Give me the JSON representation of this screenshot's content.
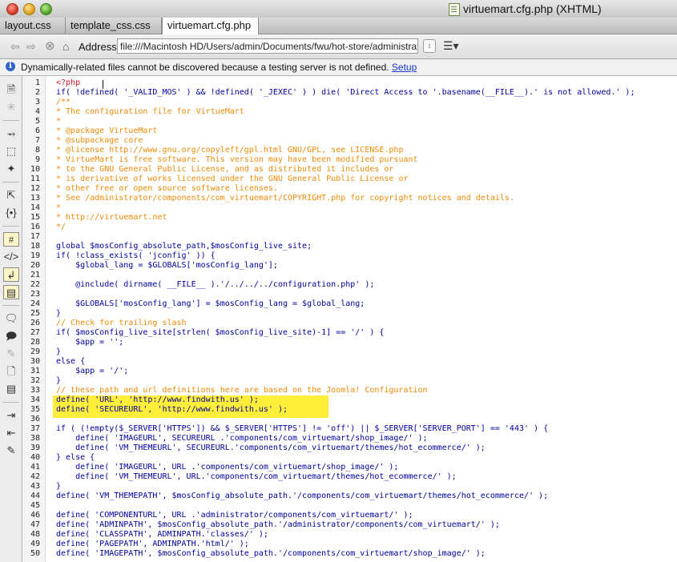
{
  "window": {
    "title": "virtuemart.cfg.php (XHTML)"
  },
  "tabs": [
    {
      "label": "layout.css",
      "active": false
    },
    {
      "label": "template_css.css",
      "active": false
    },
    {
      "label": "virtuemart.cfg.php",
      "active": true
    }
  ],
  "addressbar": {
    "label": "Address:",
    "value": "file:///Macintosh HD/Users/admin/Documents/fwu/hot-store/administrator/components/com_virtuemart/virtuemart.cfg.php"
  },
  "infobar": {
    "message": "Dynamically-related files cannot be discovered because a testing server is not defined. ",
    "link": "Setup"
  },
  "colors": {
    "php_tag": "#d8141b",
    "comment": "#ee8a09",
    "code": "#00009b",
    "highlight": "#ffef3a"
  },
  "sidebar_icons": [
    "document-icon",
    "asterisk-icon",
    "collapse-icon",
    "select-icon",
    "expand-icon",
    "select-parent-icon",
    "balance-braces-icon",
    "line-numbers-icon",
    "highlight-invalid-icon",
    "word-wrap-icon",
    "syntax-coloring-icon",
    "comment-icon",
    "uncomment-icon",
    "wrap-tag-icon",
    "recent-snippets-icon",
    "move-css-icon",
    "indent-icon",
    "outdent-icon",
    "format-source-icon"
  ],
  "code_lines": [
    {
      "n": "1",
      "t": "<?php",
      "c": "php"
    },
    {
      "n": "2",
      "t": "if( !defined( '_VALID_MOS' ) && !defined( '_JEXEC' ) ) die( 'Direct Access to '.basename(__FILE__).' is not allowed.' );",
      "c": "plain"
    },
    {
      "n": "3",
      "t": "/**",
      "c": "com"
    },
    {
      "n": "4",
      "t": "* The configuration file for VirtueMart",
      "c": "com"
    },
    {
      "n": "5",
      "t": "*",
      "c": "com"
    },
    {
      "n": "6",
      "t": "* @package VirtueMart",
      "c": "com"
    },
    {
      "n": "7",
      "t": "* @subpackage core",
      "c": "com"
    },
    {
      "n": "8",
      "t": "* @license http://www.gnu.org/copyleft/gpl.html GNU/GPL, see LICENSE.php",
      "c": "com"
    },
    {
      "n": "9",
      "t": "* VirtueMart is free software. This version may have been modified pursuant",
      "c": "com"
    },
    {
      "n": "10",
      "t": "* to the GNU General Public License, and as distributed it includes or",
      "c": "com"
    },
    {
      "n": "11",
      "t": "* is derivative of works licensed under the GNU General Public License or",
      "c": "com"
    },
    {
      "n": "12",
      "t": "* other free or open source software licenses.",
      "c": "com"
    },
    {
      "n": "13",
      "t": "* See /administrator/components/com_virtuemart/COPYRIGHT.php for copyright notices and details.",
      "c": "com"
    },
    {
      "n": "14",
      "t": "*",
      "c": "com"
    },
    {
      "n": "15",
      "t": "* http://virtuemart.net",
      "c": "com"
    },
    {
      "n": "16",
      "t": "*/",
      "c": "com"
    },
    {
      "n": "17",
      "t": "",
      "c": "plain"
    },
    {
      "n": "18",
      "t": "global $mosConfig_absolute_path,$mosConfig_live_site;",
      "c": "plain"
    },
    {
      "n": "19",
      "t": "if( !class_exists( 'jconfig' )) {",
      "c": "plain"
    },
    {
      "n": "20",
      "t": "    $global_lang = $GLOBALS['mosConfig_lang'];",
      "c": "plain"
    },
    {
      "n": "21",
      "t": "",
      "c": "plain"
    },
    {
      "n": "22",
      "t": "    @include( dirname( __FILE__ ).'/../../../configuration.php' );",
      "c": "plain"
    },
    {
      "n": "23",
      "t": "",
      "c": "plain"
    },
    {
      "n": "24",
      "t": "    $GLOBALS['mosConfig_lang'] = $mosConfig_lang = $global_lang;",
      "c": "plain"
    },
    {
      "n": "25",
      "t": "}",
      "c": "plain"
    },
    {
      "n": "26",
      "t": "// Check for trailing slash",
      "c": "com"
    },
    {
      "n": "27",
      "t": "if( $mosConfig_live_site[strlen( $mosConfig_live_site)-1] == '/' ) {",
      "c": "plain"
    },
    {
      "n": "28",
      "t": "    $app = '';",
      "c": "plain"
    },
    {
      "n": "29",
      "t": "}",
      "c": "plain"
    },
    {
      "n": "30",
      "t": "else {",
      "c": "plain"
    },
    {
      "n": "31",
      "t": "    $app = '/';",
      "c": "plain"
    },
    {
      "n": "32",
      "t": "}",
      "c": "plain"
    },
    {
      "n": "33",
      "t": "// these path and url definitions here are based on the Joomla! Configuration",
      "c": "com"
    },
    {
      "n": "34",
      "t": "define( 'URL', 'http://www.findwith.us' );",
      "c": "plain",
      "hl": true
    },
    {
      "n": "35",
      "t": "define( 'SECUREURL', 'http://www.findwith.us' );",
      "c": "plain",
      "hl": true
    },
    {
      "n": "36",
      "t": "",
      "c": "plain"
    },
    {
      "n": "37",
      "t": "if ( (!empty($_SERVER['HTTPS']) && $_SERVER['HTTPS'] != 'off') || $_SERVER['SERVER_PORT'] == '443' ) {",
      "c": "plain"
    },
    {
      "n": "38",
      "t": "    define( 'IMAGEURL', SECUREURL .'components/com_virtuemart/shop_image/' );",
      "c": "plain"
    },
    {
      "n": "39",
      "t": "    define( 'VM_THEMEURL', SECUREURL.'components/com_virtuemart/themes/hot_ecommerce/' );",
      "c": "plain"
    },
    {
      "n": "40",
      "t": "} else {",
      "c": "plain"
    },
    {
      "n": "41",
      "t": "    define( 'IMAGEURL', URL .'components/com_virtuemart/shop_image/' );",
      "c": "plain"
    },
    {
      "n": "42",
      "t": "    define( 'VM_THEMEURL', URL.'components/com_virtuemart/themes/hot_ecommerce/' );",
      "c": "plain"
    },
    {
      "n": "43",
      "t": "}",
      "c": "plain"
    },
    {
      "n": "44",
      "t": "define( 'VM_THEMEPATH', $mosConfig_absolute_path.'/components/com_virtuemart/themes/hot_ecommerce/' );",
      "c": "plain"
    },
    {
      "n": "45",
      "t": "",
      "c": "plain"
    },
    {
      "n": "46",
      "t": "define( 'COMPONENTURL', URL .'administrator/components/com_virtuemart/' );",
      "c": "plain"
    },
    {
      "n": "47",
      "t": "define( 'ADMINPATH', $mosConfig_absolute_path.'/administrator/components/com_virtuemart/' );",
      "c": "plain"
    },
    {
      "n": "48",
      "t": "define( 'CLASSPATH', ADMINPATH.'classes/' );",
      "c": "plain"
    },
    {
      "n": "49",
      "t": "define( 'PAGEPATH', ADMINPATH.'html/' );",
      "c": "plain"
    },
    {
      "n": "50",
      "t": "define( 'IMAGEPATH', $mosConfig_absolute_path.'/components/com_virtuemart/shop_image/' );",
      "c": "plain"
    }
  ]
}
